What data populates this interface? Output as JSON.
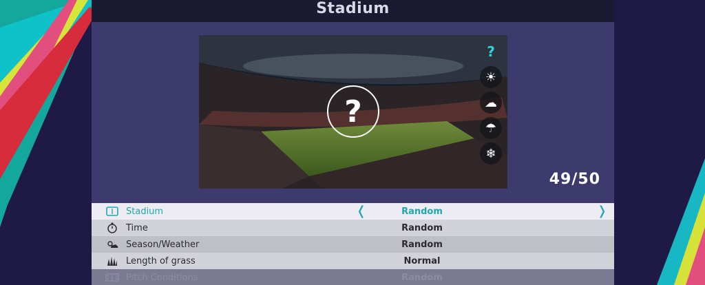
{
  "screen": {
    "title": "Stadium"
  },
  "preview": {
    "unknown_symbol": "?",
    "counter": "49/50",
    "weather_options": [
      {
        "name": "random",
        "glyph": "?",
        "active": true
      },
      {
        "name": "sunny",
        "glyph": "☀",
        "active": false
      },
      {
        "name": "cloudy-rain",
        "glyph": "☁",
        "active": false
      },
      {
        "name": "rain",
        "glyph": "☂",
        "active": false
      },
      {
        "name": "snow",
        "glyph": "❄",
        "active": false
      }
    ]
  },
  "settings": [
    {
      "label": "Stadium",
      "value": "Random",
      "icon": "stadium-icon",
      "selected": true,
      "left_arrow": "❬",
      "right_arrow": "❭"
    },
    {
      "label": "Time",
      "value": "Random",
      "icon": "stopwatch-icon"
    },
    {
      "label": "Season/Weather",
      "value": "Random",
      "icon": "sun-cloud-icon"
    },
    {
      "label": "Length of grass",
      "value": "Normal",
      "icon": "grass-icon"
    },
    {
      "label": "Pitch Conditions",
      "value": "Random",
      "icon": "pitch-icon",
      "disabled": true
    }
  ],
  "colors": {
    "accent": "#1fa7ad",
    "panel": "#3d3a6e",
    "title_bar": "#1b1a33"
  }
}
